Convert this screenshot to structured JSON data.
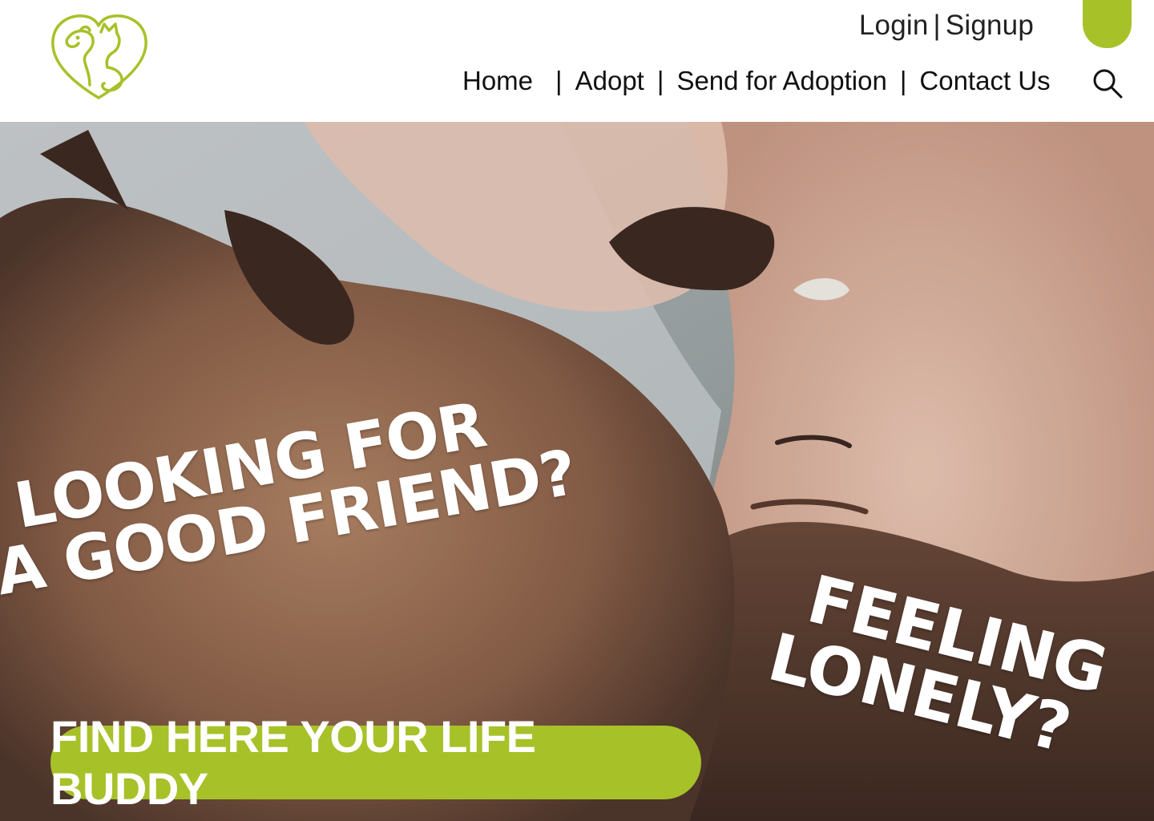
{
  "brand": {
    "accent_color": "#a7c128",
    "logo_icon": "dog-cat-heart-icon"
  },
  "auth": {
    "login": "Login",
    "separator": "|",
    "signup": "Signup"
  },
  "nav": {
    "items": [
      "Home",
      "Adopt",
      "Send for Adoption",
      "Contact Us"
    ],
    "separator": "|"
  },
  "search": {
    "icon": "search-icon"
  },
  "hero": {
    "headline_left": {
      "line1": "LOOKING FOR",
      "line2": "A GOOD FRIEND?"
    },
    "headline_right": {
      "line1": "FEELING",
      "line2": "LONELY?"
    },
    "cta": "FIND HERE YOUR LIFE BUDDY"
  }
}
